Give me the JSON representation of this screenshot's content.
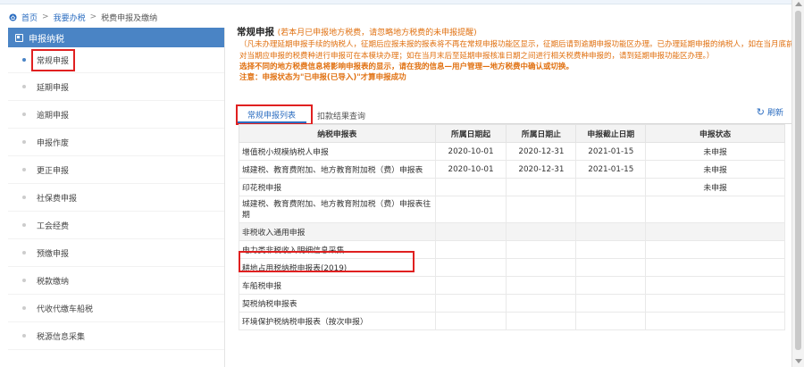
{
  "breadcrumb": {
    "home": "首页",
    "level1": "我要办税",
    "level2": "税费申报及缴纳",
    "sep": ">"
  },
  "sidebar": {
    "header": "申报纳税",
    "items": [
      {
        "label": "常规申报",
        "active": true
      },
      {
        "label": "延期申报"
      },
      {
        "label": "逾期申报"
      },
      {
        "label": "申报作废"
      },
      {
        "label": "更正申报"
      },
      {
        "label": "社保费申报"
      },
      {
        "label": "工会经费"
      },
      {
        "label": "预缴申报"
      },
      {
        "label": "税款缴纳"
      },
      {
        "label": "代收代缴车船税"
      },
      {
        "label": "税源信息采集"
      }
    ]
  },
  "main": {
    "title": "常规申报",
    "title_hint": "(若本月已申报地方税费，请忽略地方税费的未申报提醒)",
    "notice1": "（凡未办理延期申报手续的纳税人，征期后应报未报的报表将不再在常规申报功能区显示，征期后请到逾期申报功能区办理。已办理延期申报的纳税人，如在当月底前对当期应申报的税费种进行申报可在本模块办理；如在当月末后至延期申报核准日期之间进行相关税费种申报的，请到延期申报功能区办理。）",
    "notice2": "选择不同的地方税费信息将影响申报表的显示，请在我的信息—用户管理—地方税费中确认或切换。",
    "notice3": "注意：申报状态为\"已申报(已导入)\"才算申报成功",
    "tabs": [
      "常规申报列表",
      "扣款结果查询"
    ],
    "refresh": "刷新"
  },
  "table": {
    "headers": [
      "纳税申报表",
      "所属日期起",
      "所属日期止",
      "申报截止日期",
      "申报状态"
    ],
    "rows": [
      [
        "增值税小规模纳税人申报",
        "2020-10-01",
        "2020-12-31",
        "2021-01-15",
        "未申报"
      ],
      [
        "城建税、教育费附加、地方教育附加税（费）申报表",
        "2020-10-01",
        "2020-12-31",
        "2021-01-15",
        "未申报"
      ],
      [
        "印花税申报",
        "",
        "",
        "",
        "未申报"
      ],
      [
        "城建税、教育费附加、地方教育附加税（费）申报表往期",
        "",
        "",
        "",
        ""
      ],
      [
        "非税收入通用申报",
        "",
        "",
        "",
        ""
      ],
      [
        "电力类非税收入明细信息采集",
        "",
        "",
        "",
        ""
      ],
      [
        "耕地占用税纳税申报表(2019)",
        "",
        "",
        "",
        ""
      ],
      [
        "车船税申报",
        "",
        "",
        "",
        ""
      ],
      [
        "契税纳税申报表",
        "",
        "",
        "",
        ""
      ],
      [
        "环境保护税纳税申报表（按次申报）",
        "",
        "",
        "",
        ""
      ]
    ]
  },
  "colors": {
    "accent": "#4a84c5",
    "link": "#2a6cc0",
    "warning": "#e07010",
    "highlight": "#e02020"
  }
}
